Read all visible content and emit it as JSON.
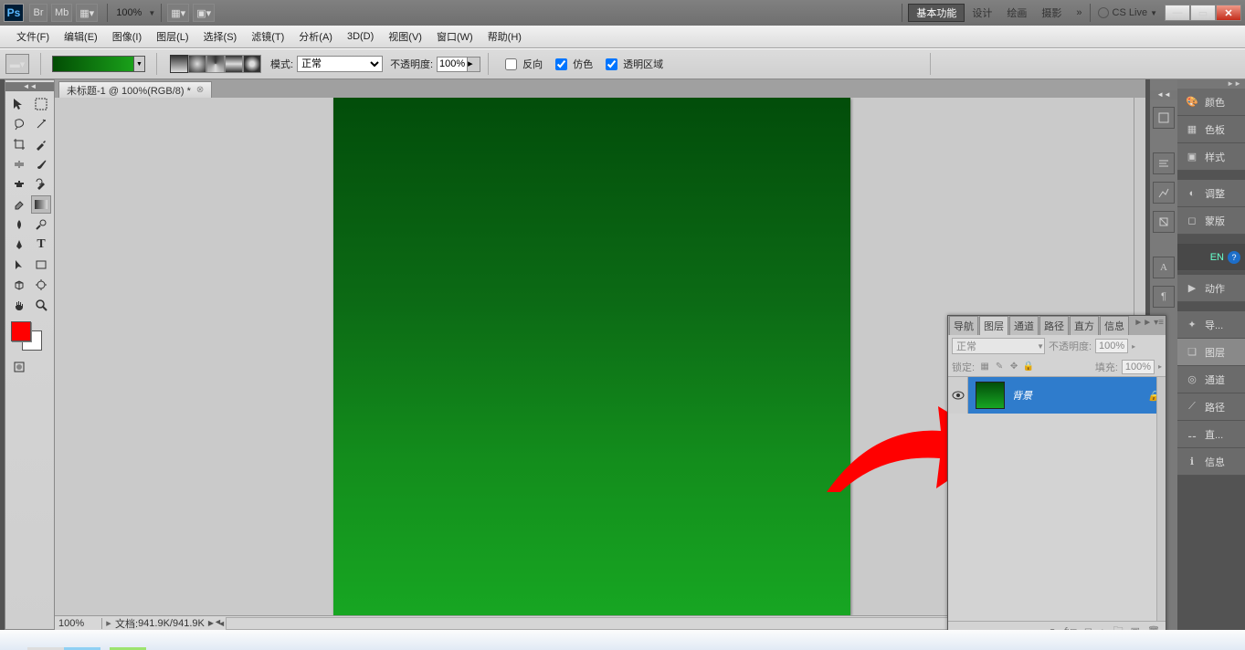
{
  "title_bar": {
    "ps": "Ps",
    "br": "Br",
    "mb": "Mb",
    "zoom": "100%",
    "workspace_active": "基本功能",
    "workspaces": [
      "设计",
      "绘画",
      "摄影"
    ],
    "more": "»",
    "cslive": "CS Live"
  },
  "menu": [
    "文件(F)",
    "编辑(E)",
    "图像(I)",
    "图层(L)",
    "选择(S)",
    "滤镜(T)",
    "分析(A)",
    "3D(D)",
    "视图(V)",
    "窗口(W)",
    "帮助(H)"
  ],
  "options": {
    "mode_lbl": "模式:",
    "mode_val": "正常",
    "opacity_lbl": "不透明度:",
    "opacity_val": "100%",
    "reverse": "反向",
    "dither": "仿色",
    "transparency": "透明区域"
  },
  "doc_tab": "未标题-1 @ 100%(RGB/8) *",
  "status": {
    "zoom": "100%",
    "info_lbl": "文档:",
    "info_val": "941.9K/941.9K"
  },
  "right_panels": [
    "颜色",
    "色板",
    "样式"
  ],
  "right_panels2": [
    "调整",
    "蒙版"
  ],
  "right_panels3": [
    "动作"
  ],
  "right_panels4": [
    "导...",
    "图层",
    "通道",
    "路径",
    "直...",
    "信息"
  ],
  "lang": "EN",
  "layers_panel": {
    "tabs": [
      "导航",
      "图层",
      "通道",
      "路径",
      "直方",
      "信息"
    ],
    "blend": "正常",
    "opacity_lbl": "不透明度:",
    "opacity_val": "100%",
    "lock_lbl": "锁定:",
    "fill_lbl": "填充:",
    "fill_val": "100%",
    "layer_name": "背景"
  }
}
